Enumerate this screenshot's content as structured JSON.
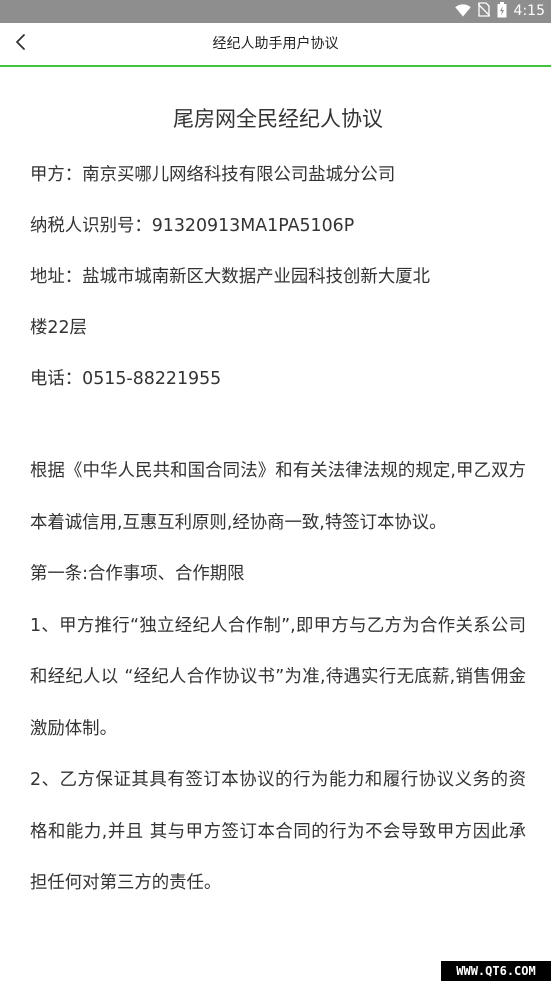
{
  "status_bar": {
    "time": "4:15",
    "icons": [
      "wifi-icon",
      "no-sim-icon",
      "battery-icon"
    ]
  },
  "nav": {
    "title": "经纪人助手用户协议",
    "back_icon": "chevron-left-icon",
    "accent_color": "#3ec43e"
  },
  "document": {
    "title": "尾房网全民经纪人协议",
    "party_a": "甲方：南京买哪儿网络科技有限公司盐城分公司",
    "tax_id": "纳税人识别号：91320913MA1PA5106P",
    "address_line1": "地址：盐城市城南新区大数据产业园科技创新大厦北",
    "address_line2": "楼22层",
    "phone": "电话：0515-88221955",
    "intro": "根据《中华人民共和国合同法》和有关法律法规的规定,甲乙双方本着诚信用,互惠互利原则,经协商一致,特签订本协议。",
    "article1_heading": "第一条:合作事项、合作期限",
    "clause1": "1、甲方推行“独立经纪人合作制”,即甲方与乙方为合作关系公司和经纪人以 “经纪人合作协议书”为准,待遇实行无底薪,销售佣金激励体制。",
    "clause2": "2、乙方保证其具有签订本协议的行为能力和履行协议义务的资格和能力,并且 其与甲方签订本合同的行为不会导致甲方因此承担任何对第三方的责任。"
  },
  "watermark": {
    "text": "WWW.QT6.COM"
  }
}
